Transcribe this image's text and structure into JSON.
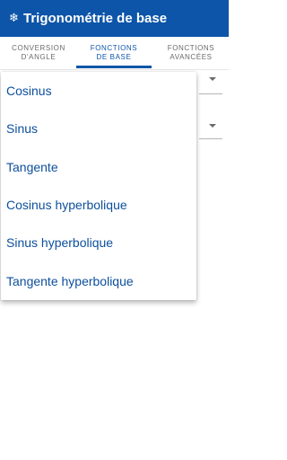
{
  "app_bar": {
    "icon": "snowflake-icon",
    "title": "Trigonométrie de base",
    "color": "#0d55a8"
  },
  "tabs": [
    {
      "line1": "CONVERSION",
      "line2": "D'ANGLE",
      "active": false
    },
    {
      "line1": "FONCTIONS",
      "line2": "DE BASE",
      "active": true
    },
    {
      "line1": "FONCTIONS",
      "line2": "AVANCÉES",
      "active": false
    }
  ],
  "dropdown_menu": {
    "items": [
      "Cosinus",
      "Sinus",
      "Tangente",
      "Cosinus hyperbolique",
      "Sinus hyperbolique",
      "Tangente hyperbolique"
    ]
  }
}
